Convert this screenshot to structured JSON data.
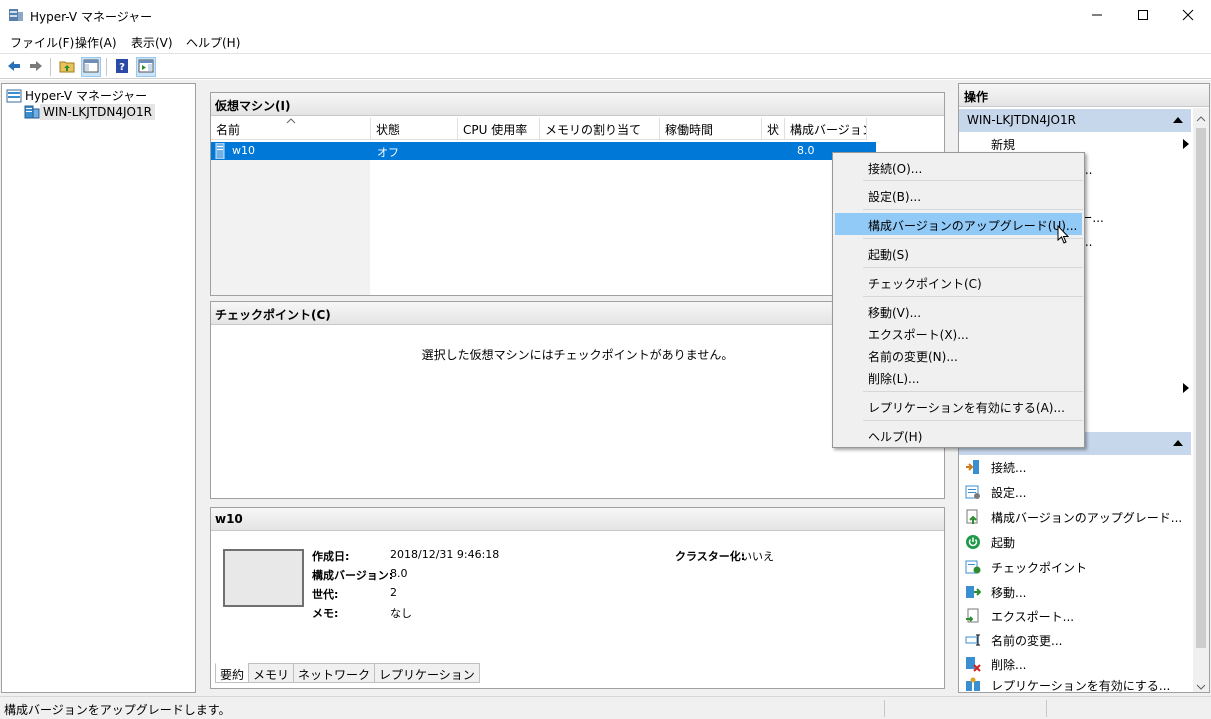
{
  "window": {
    "title": "Hyper-V マネージャー"
  },
  "menu": [
    "ファイル(F)",
    "操作(A)",
    "表示(V)",
    "ヘルプ(H)"
  ],
  "tree": {
    "root": "Hyper-V マネージャー",
    "server": "WIN-LKJTDN4JO1R"
  },
  "vm_pane": {
    "title": "仮想マシン(I)",
    "columns": [
      "名前",
      "状態",
      "CPU 使用率",
      "メモリの割り当て",
      "稼働時間",
      "状",
      "構成バージョン"
    ],
    "row": {
      "name": "w10",
      "state": "オフ",
      "version": "8.0"
    }
  },
  "checkpoint_pane": {
    "title": "チェックポイント(C)",
    "empty": "選択した仮想マシンにはチェックポイントがありません。"
  },
  "details_pane": {
    "title": "w10",
    "created_label": "作成日:",
    "created_value": "2018/12/31 9:46:18",
    "version_label": "構成バージョン:",
    "version_value": "8.0",
    "gen_label": "世代:",
    "gen_value": "2",
    "memo_label": "メモ:",
    "memo_value": "なし",
    "cluster_label": "クラスター化:",
    "cluster_value": "いいえ",
    "tabs": [
      "要約",
      "メモリ",
      "ネットワーク",
      "レプリケーション"
    ]
  },
  "actions": {
    "title": "操作",
    "server_group": "WIN-LKJTDN4JO1R",
    "server_items": [
      "新規",
      "ート...",
      "ジャー...",
      "ャー..."
    ],
    "vm_items": [
      "接続...",
      "設定...",
      "構成バージョンのアップグレード...",
      "起動",
      "チェックポイント",
      "移動...",
      "エクスポート...",
      "名前の変更...",
      "削除...",
      "レプリケーションを有効にする..."
    ]
  },
  "context_menu": [
    "接続(O)...",
    "設定(B)...",
    "構成バージョンのアップグレード(U)...",
    "起動(S)",
    "チェックポイント(C)",
    "移動(V)...",
    "エクスポート(X)...",
    "名前の変更(N)...",
    "削除(L)...",
    "レプリケーションを有効にする(A)...",
    "ヘルプ(H)"
  ],
  "status": {
    "text": "構成バージョンをアップグレードします。"
  }
}
